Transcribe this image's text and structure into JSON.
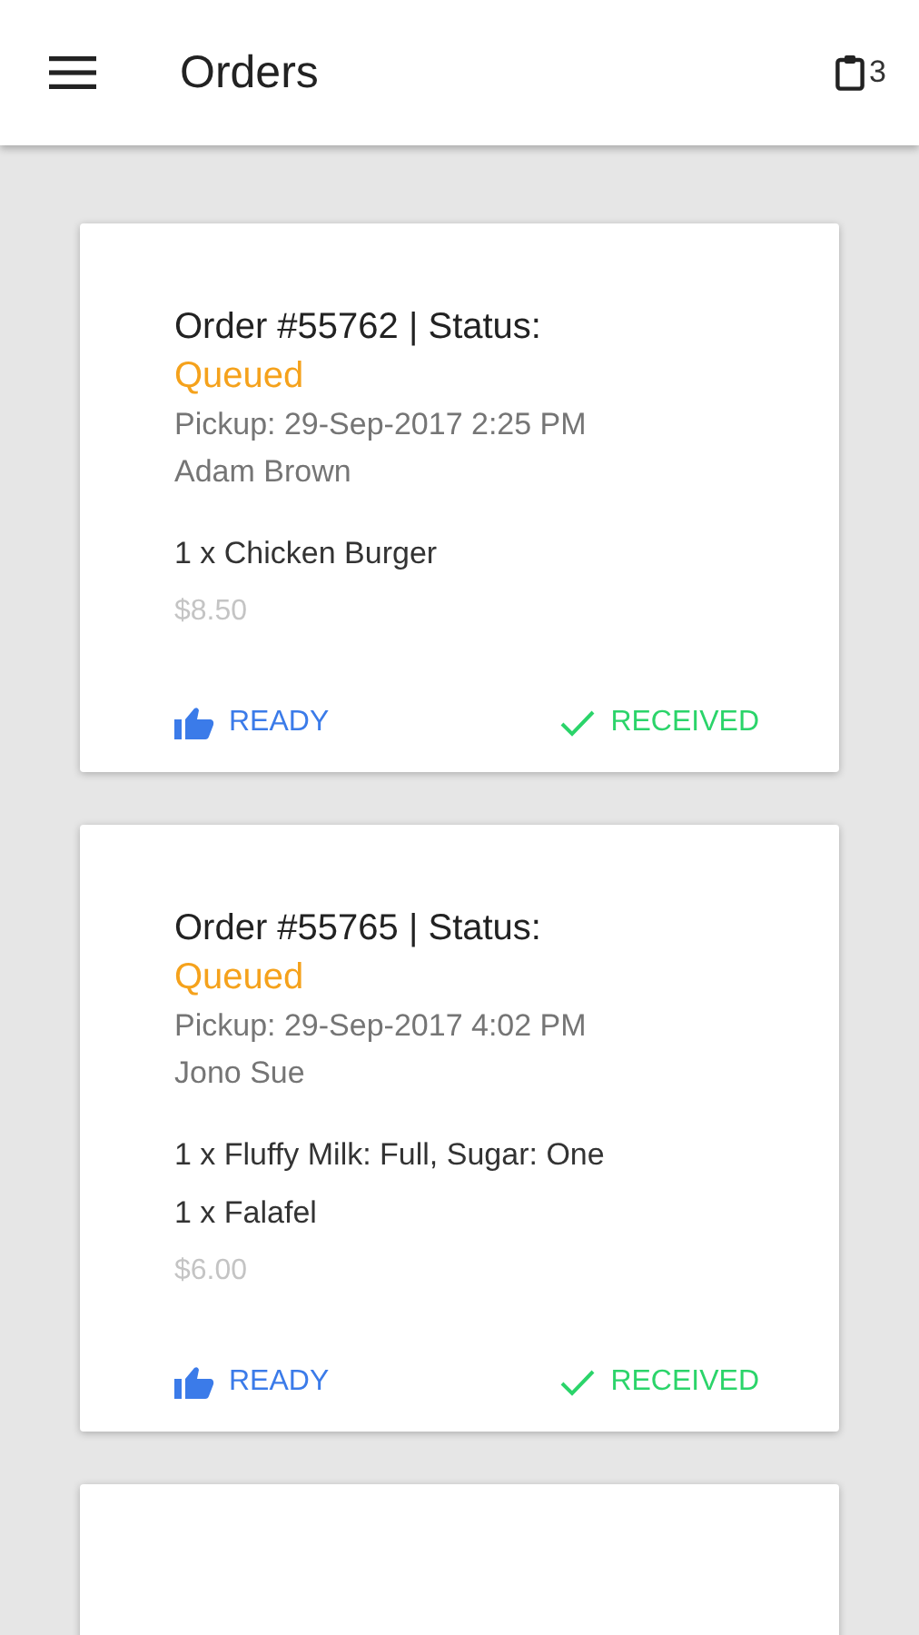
{
  "app_bar": {
    "title": "Orders",
    "order_count": "3"
  },
  "orders": [
    {
      "title": "Order #55762 | Status:",
      "status": "Queued",
      "pickup": "Pickup: 29-Sep-2017 2:25 PM",
      "customer": "Adam Brown",
      "items": [
        "1 x Chicken Burger"
      ],
      "price": "$8.50",
      "actions": [
        {
          "kind": "ready",
          "label": "READY"
        },
        {
          "kind": "received",
          "label": "RECEIVED"
        }
      ]
    },
    {
      "title": "Order #55765 | Status:",
      "status": "Queued",
      "pickup": "Pickup: 29-Sep-2017 4:02 PM",
      "customer": "Jono Sue",
      "items": [
        "1 x Fluffy Milk: Full, Sugar: One",
        "1 x Falafel"
      ],
      "price": "$6.00",
      "actions": [
        {
          "kind": "ready",
          "label": "READY"
        },
        {
          "kind": "received",
          "label": "RECEIVED"
        }
      ]
    }
  ],
  "partial_card": {
    "kind": "card"
  }
}
